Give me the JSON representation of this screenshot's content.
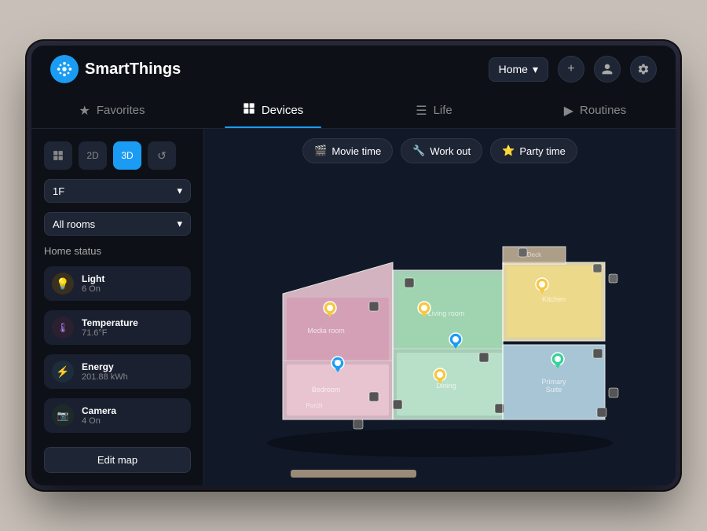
{
  "app": {
    "logo_text": "SmartThings",
    "home_selector": "Home",
    "home_selector_arrow": "▾",
    "header_buttons": [
      "+",
      "👤",
      "⚙"
    ]
  },
  "nav": {
    "tabs": [
      {
        "id": "favorites",
        "label": "Favorites",
        "icon": "★",
        "active": false
      },
      {
        "id": "devices",
        "label": "Devices",
        "icon": "⊞",
        "active": true
      },
      {
        "id": "life",
        "label": "Life",
        "icon": "☰",
        "active": false
      },
      {
        "id": "routines",
        "label": "Routines",
        "icon": "▶",
        "active": false
      }
    ]
  },
  "sidebar": {
    "view_buttons": [
      {
        "id": "grid",
        "label": "⊞",
        "active": false
      },
      {
        "id": "2d",
        "label": "2D",
        "active": false
      },
      {
        "id": "3d",
        "label": "3D",
        "active": true
      },
      {
        "id": "history",
        "label": "↺",
        "active": false
      }
    ],
    "floor_label": "1F",
    "floor_arrow": "▾",
    "room_label": "All rooms",
    "room_arrow": "▾",
    "home_status_label": "Home status",
    "status_items": [
      {
        "id": "light",
        "icon": "💡",
        "name": "Light",
        "value": "6 On",
        "type": "light"
      },
      {
        "id": "temp",
        "icon": "🌡",
        "name": "Temperature",
        "value": "71.6°F",
        "type": "temp"
      },
      {
        "id": "energy",
        "icon": "⚡",
        "name": "Energy",
        "value": "201.88 kWh",
        "type": "energy"
      },
      {
        "id": "camera",
        "icon": "📷",
        "name": "Camera",
        "value": "4 On",
        "type": "camera"
      }
    ],
    "edit_map_btn": "Edit map"
  },
  "scenes": [
    {
      "id": "movie",
      "icon": "🎬",
      "label": "Movie time"
    },
    {
      "id": "workout",
      "icon": "🔧",
      "label": "Work out"
    },
    {
      "id": "party",
      "icon": "⭐",
      "label": "Party time"
    }
  ]
}
